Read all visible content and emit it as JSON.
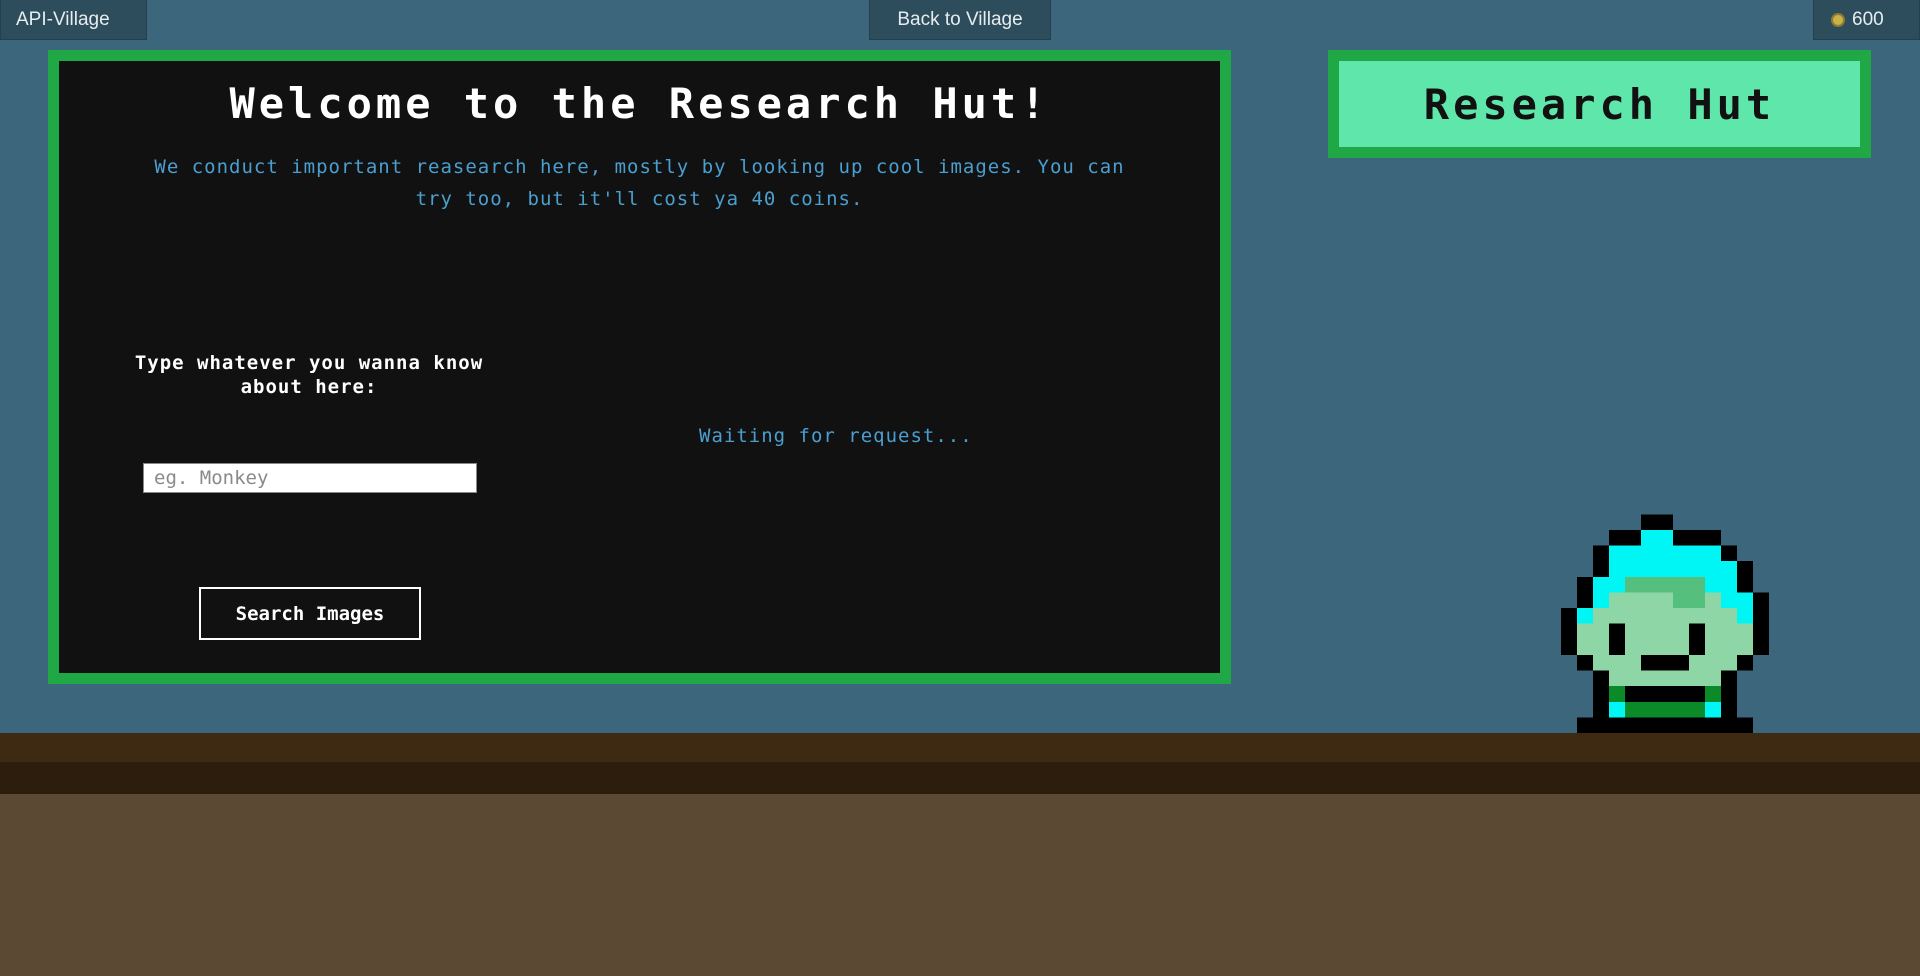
{
  "header": {
    "brand": "API-Village",
    "back_label": "Back to Village",
    "coins": "600"
  },
  "board": {
    "title": "Welcome to the Research Hut!",
    "intro": "We conduct important reasearch here, mostly by looking up cool images. You can try too, but it'll cost ya 40 coins.",
    "prompt": "Type whatever you wanna know about here:",
    "search_placeholder": "eg. Monkey",
    "search_value": "",
    "search_button": "Search Images",
    "status": "Waiting for request..."
  },
  "sign": {
    "label": "Research Hut"
  },
  "icons": {
    "coin": "coin-icon",
    "character": "pixel-character"
  },
  "colors": {
    "background": "#3c667b",
    "board_border": "#1fa845",
    "board_bg": "#111111",
    "sign_bg": "#5fe7ab",
    "accent_text": "#4a9fd0",
    "character_hair": "#00f5f5",
    "character_skin": "#8ed6a5"
  }
}
